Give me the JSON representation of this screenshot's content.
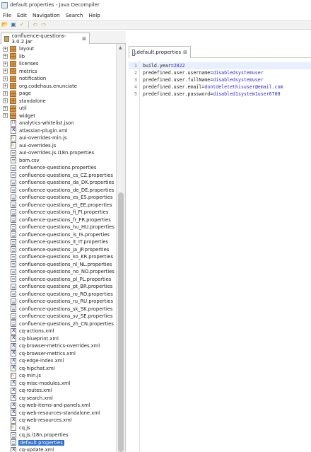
{
  "window": {
    "title": "default.properties - Java Decompiler"
  },
  "menubar": {
    "items": [
      "File",
      "Edit",
      "Navigation",
      "Search",
      "Help"
    ]
  },
  "toolbar": {
    "icons": [
      "open-file-icon",
      "save-icon",
      "pin-icon",
      "back-arrow-icon",
      "forward-arrow-icon"
    ]
  },
  "left_tab": {
    "label": "confluence-questions-3.0.2.jar",
    "close": "⊠"
  },
  "tree": {
    "packages": [
      {
        "name": "layout"
      },
      {
        "name": "lib"
      },
      {
        "name": "licenses"
      },
      {
        "name": "metrics"
      },
      {
        "name": "notification"
      },
      {
        "name": "org.codehaus.enunciate"
      },
      {
        "name": "page"
      },
      {
        "name": "standalone"
      },
      {
        "name": "util"
      },
      {
        "name": "widget"
      }
    ],
    "files": [
      {
        "name": "analytics-whitelist.json",
        "kind": "json"
      },
      {
        "name": "atlassian-plugin.xml",
        "kind": "xml"
      },
      {
        "name": "aui-overrides-min.js",
        "kind": "js"
      },
      {
        "name": "aui-overrides.js",
        "kind": "js"
      },
      {
        "name": "aui-overrides.js.i18n.properties",
        "kind": "props"
      },
      {
        "name": "bom.csv",
        "kind": "csv"
      },
      {
        "name": "confluence-questions.properties",
        "kind": "props"
      },
      {
        "name": "confluence-questions_cs_CZ.properties",
        "kind": "props"
      },
      {
        "name": "confluence-questions_da_DK.properties",
        "kind": "props"
      },
      {
        "name": "confluence-questions_de_DE.properties",
        "kind": "props"
      },
      {
        "name": "confluence-questions_es_ES.properties",
        "kind": "props"
      },
      {
        "name": "confluence-questions_et_EE.properties",
        "kind": "props"
      },
      {
        "name": "confluence-questions_fi_FI.properties",
        "kind": "props"
      },
      {
        "name": "confluence-questions_fr_FR.properties",
        "kind": "props"
      },
      {
        "name": "confluence-questions_hu_HU.properties",
        "kind": "props"
      },
      {
        "name": "confluence-questions_is_IS.properties",
        "kind": "props"
      },
      {
        "name": "confluence-questions_it_IT.properties",
        "kind": "props"
      },
      {
        "name": "confluence-questions_ja_JP.properties",
        "kind": "props"
      },
      {
        "name": "confluence-questions_ko_KR.properties",
        "kind": "props"
      },
      {
        "name": "confluence-questions_nl_NL.properties",
        "kind": "props"
      },
      {
        "name": "confluence-questions_no_NO.properties",
        "kind": "props"
      },
      {
        "name": "confluence-questions_pl_PL.properties",
        "kind": "props"
      },
      {
        "name": "confluence-questions_pt_BR.properties",
        "kind": "props"
      },
      {
        "name": "confluence-questions_ro_RO.properties",
        "kind": "props"
      },
      {
        "name": "confluence-questions_ru_RU.properties",
        "kind": "props"
      },
      {
        "name": "confluence-questions_sk_SK.properties",
        "kind": "props"
      },
      {
        "name": "confluence-questions_sv_SE.properties",
        "kind": "props"
      },
      {
        "name": "confluence-questions_zh_CN.properties",
        "kind": "props"
      },
      {
        "name": "cq-actions.xml",
        "kind": "xml"
      },
      {
        "name": "cq-blueprint.xml",
        "kind": "xml"
      },
      {
        "name": "cq-browser-metrics-overrides.xml",
        "kind": "xml"
      },
      {
        "name": "cq-browser-metrics.xml",
        "kind": "xml"
      },
      {
        "name": "cq-edge-index.xml",
        "kind": "xml"
      },
      {
        "name": "cq-hipchat.xml",
        "kind": "xml"
      },
      {
        "name": "cq-min.js",
        "kind": "js"
      },
      {
        "name": "cq-misc-modules.xml",
        "kind": "xml"
      },
      {
        "name": "cq-routes.xml",
        "kind": "xml"
      },
      {
        "name": "cq-search.xml",
        "kind": "xml"
      },
      {
        "name": "cq-web-items-and-panels.xml",
        "kind": "xml"
      },
      {
        "name": "cq-web-resources-standalone.xml",
        "kind": "xml"
      },
      {
        "name": "cq-web-resources.xml",
        "kind": "xml"
      },
      {
        "name": "cq.js",
        "kind": "js"
      },
      {
        "name": "cq.js.i18n.properties",
        "kind": "props"
      },
      {
        "name": "default.properties",
        "kind": "props",
        "selected": true
      },
      {
        "name": "cq-update.xml",
        "kind": "xml"
      }
    ]
  },
  "right_tab": {
    "label": "default.properties",
    "close": "⊠"
  },
  "editor": {
    "lines": [
      {
        "num": "1",
        "key": "build.year",
        "value": "2022"
      },
      {
        "num": "2",
        "key": "predefined.user.username",
        "value": "disabledsystemuser"
      },
      {
        "num": "3",
        "key": "predefined.user.fullName",
        "value": "disabledsystemuser"
      },
      {
        "num": "4",
        "key": "predefined.user.email",
        "value": "dontdeletethisuser@email.com"
      },
      {
        "num": "5",
        "key": "predefined.user.password",
        "value": "disabled1system1user6708"
      }
    ]
  }
}
